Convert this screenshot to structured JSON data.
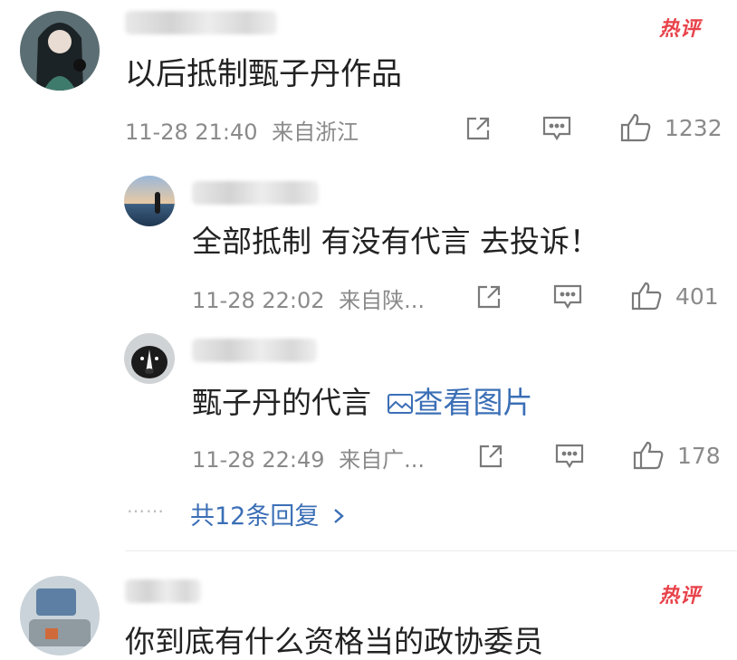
{
  "comments": [
    {
      "badge": "热评",
      "text": "以后抵制甄子丹作品",
      "time": "11-28 21:40",
      "location": "来自浙江",
      "likes": "1232"
    },
    {
      "text": "全部抵制 有没有代言 去投诉！",
      "time": "11-28 22:02",
      "location": "来自陕...",
      "likes": "401"
    },
    {
      "text": "甄子丹的代言",
      "link": "查看图片",
      "time": "11-28 22:49",
      "location": "来自广...",
      "likes": "178"
    },
    {
      "badge": "热评",
      "text": "你到底有什么资格当的政协委员"
    }
  ],
  "more_replies": "共12条回复",
  "more_dots": "……",
  "icons": {
    "share": "share-icon",
    "comment": "comment-icon",
    "like": "thumbs-up-icon",
    "image": "image-icon",
    "chevron": "chevron-right-icon"
  },
  "colors": {
    "hot_badge": "#e8424a",
    "link": "#3b6fb6",
    "meta": "#8a8a8a"
  }
}
